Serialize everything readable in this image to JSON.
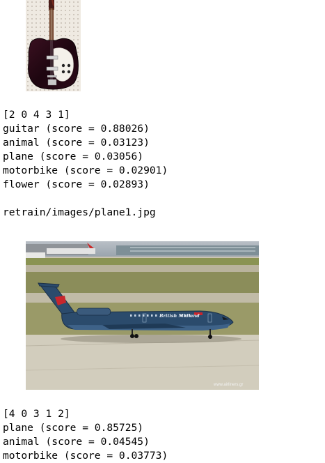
{
  "first_result": {
    "image_subject": "guitar",
    "order": "[2 0 4 3 1]",
    "predictions": [
      "guitar (score = 0.88026)",
      "animal (score = 0.03123)",
      "plane (score = 0.03056)",
      "motorbike (score = 0.02901)",
      "flower (score = 0.02893)"
    ]
  },
  "second_result": {
    "path": "retrain/images/plane1.jpg",
    "image_subject": "plane",
    "livery_text": "British Midland",
    "photo_credit": "www.airliners.gr",
    "order": "[4 0 3 1 2]",
    "predictions": [
      "plane (score = 0.85725)",
      "animal (score = 0.04545)",
      "motorbike (score = 0.03773)"
    ]
  }
}
